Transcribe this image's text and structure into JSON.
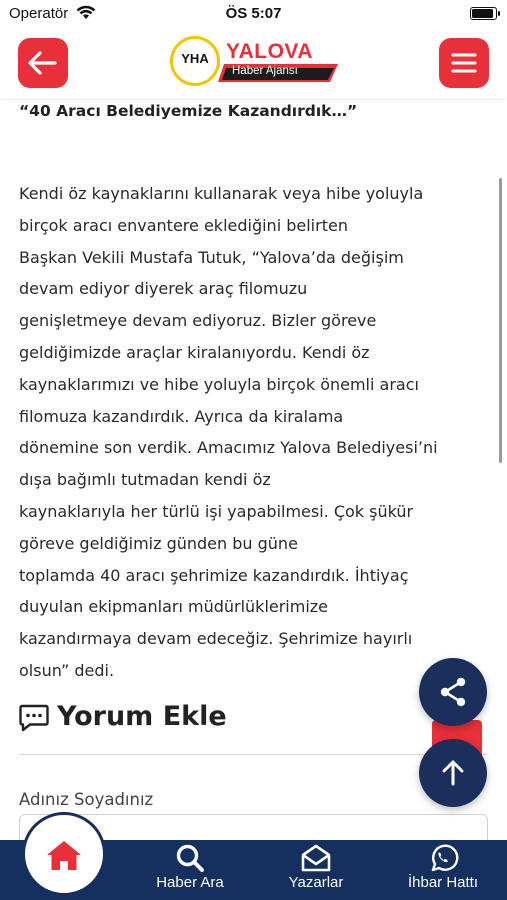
{
  "status_bar": {
    "carrier": "Operatör",
    "time": "ÖS 5:07"
  },
  "header": {
    "logo": {
      "ring_text": "YHA",
      "brand": "YALOVA",
      "subtitle": "Haber Ajansı"
    },
    "back_icon": "arrow-left-icon",
    "menu_icon": "hamburger-menu-icon",
    "accent_color": "#e8303a"
  },
  "article": {
    "quote": "“40 Aracı Belediyemize Kazandırdık…”",
    "lines": [
      "Kendi öz kaynaklarını kullanarak veya hibe yoluyla",
      "birçok aracı envantere eklediğini belirten",
      "Başkan Vekili Mustafa Tutuk, “Yalova’da değişim",
      "devam ediyor diyerek araç filomuzu",
      "genişletmeye devam ediyoruz. Bizler göreve",
      "geldiğimizde araçlar kiralanıyordu. Kendi öz",
      "kaynaklarımızı ve hibe yoluyla birçok önemli aracı",
      "filomuza kazandırdık. Ayrıca da kiralama",
      "dönemine son verdik. Amacımız Yalova Belediyesi’ni",
      "dışa bağımlı tutmadan kendi öz",
      "kaynaklarıyla her türlü işi yapabilmesi. Çok şükür",
      "göreve geldiğimiz günden bu güne",
      "toplamda 40 aracı şehrimize kazandırdık. İhtiyaç",
      "duyulan ekipmanları müdürlüklerimize",
      "kazandırmaya devam edeceğiz. Şehrimize hayırlı",
      "olsun” dedi."
    ]
  },
  "comments": {
    "title": "Yorum Ekle",
    "name_label": "Adınız Soyadınız",
    "name_value": ""
  },
  "bottom_nav": {
    "color": "#15305f",
    "items": [
      {
        "label": "Haber Ara",
        "icon": "search-icon"
      },
      {
        "label": "Yazarlar",
        "icon": "envelope-open-icon"
      },
      {
        "label": "İhbar Hattı",
        "icon": "whatsapp-icon"
      }
    ],
    "home_icon": "home-icon"
  },
  "fabs": {
    "share_icon": "share-icon",
    "up_icon": "arrow-up-icon",
    "color": "#1b2f5c"
  }
}
